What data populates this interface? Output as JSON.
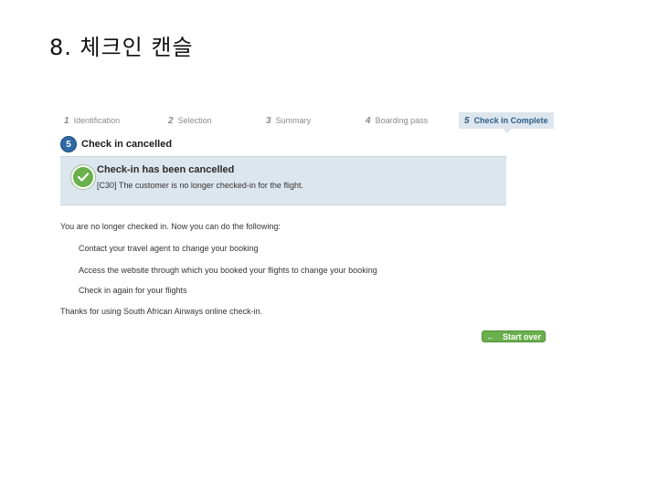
{
  "slide": {
    "title": "8. 체크인 캔슬"
  },
  "steps": [
    {
      "num": "1",
      "label": "Identification"
    },
    {
      "num": "2",
      "label": "Selection"
    },
    {
      "num": "3",
      "label": "Summary"
    },
    {
      "num": "4",
      "label": "Boarding pass"
    },
    {
      "num": "5",
      "label": "Check in Complete"
    }
  ],
  "section": {
    "badge": "5",
    "title": "Check in cancelled"
  },
  "status": {
    "title": "Check-in has been cancelled",
    "message": "[C30] The customer is no longer checked-in for the flight."
  },
  "content": {
    "intro": "You are no longer checked in. Now you can do the following:",
    "options": [
      "Contact your travel agent to change your booking",
      "Access the website through which you booked your flights to change your booking",
      "Check in again for your flights"
    ],
    "thanks": "Thanks for using South African Airways online check-in."
  },
  "actions": {
    "start_over": "Start over",
    "start_over_icon": "arrow-left-icon"
  },
  "colors": {
    "accent_blue": "#2f6aa6",
    "panel_bg": "#dce6ee",
    "success_green": "#6ab04c"
  }
}
